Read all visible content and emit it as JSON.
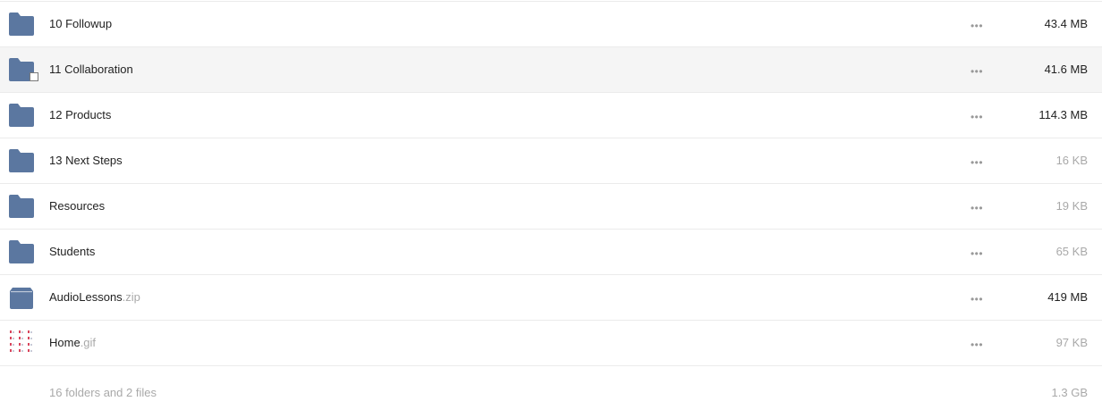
{
  "files": [
    {
      "name": "10 Followup",
      "ext": "",
      "type": "folder",
      "icon": "folder-icon",
      "size": "43.4 MB",
      "size_muted": false,
      "hovered": false
    },
    {
      "name": "11 Collaboration",
      "ext": "",
      "type": "folder",
      "icon": "folder-icon",
      "size": "41.6 MB",
      "size_muted": false,
      "hovered": true
    },
    {
      "name": "12 Products",
      "ext": "",
      "type": "folder",
      "icon": "folder-icon",
      "size": "114.3 MB",
      "size_muted": false,
      "hovered": false
    },
    {
      "name": "13 Next Steps",
      "ext": "",
      "type": "folder",
      "icon": "folder-icon",
      "size": "16 KB",
      "size_muted": true,
      "hovered": false
    },
    {
      "name": "Resources",
      "ext": "",
      "type": "folder",
      "icon": "folder-icon",
      "size": "19 KB",
      "size_muted": true,
      "hovered": false
    },
    {
      "name": "Students",
      "ext": "",
      "type": "folder",
      "icon": "folder-icon",
      "size": "65 KB",
      "size_muted": true,
      "hovered": false
    },
    {
      "name": "AudioLessons",
      "ext": ".zip",
      "type": "zip",
      "icon": "archive-icon",
      "size": "419 MB",
      "size_muted": false,
      "hovered": false
    },
    {
      "name": "Home",
      "ext": ".gif",
      "type": "image",
      "icon": "image-thumbnail-icon",
      "size": "97 KB",
      "size_muted": true,
      "hovered": false
    }
  ],
  "actions_glyph": "•••",
  "summary": {
    "text": "16 folders and 2 files",
    "total_size": "1.3 GB"
  },
  "colors": {
    "folder": "#5b77a0",
    "hover_bg": "#f5f5f5",
    "muted_text": "#a9a9a9",
    "divider": "#ebebeb"
  }
}
